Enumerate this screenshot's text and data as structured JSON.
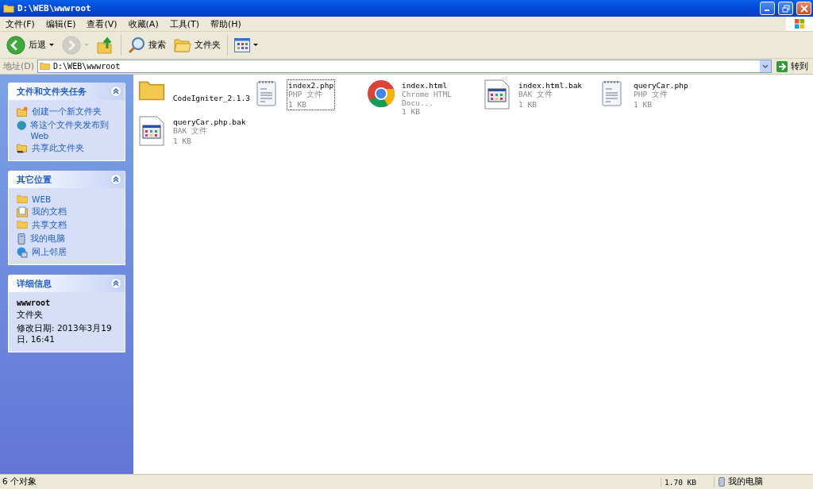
{
  "window": {
    "title": "D:\\WEB\\wwwroot"
  },
  "menu": [
    "文件(F)",
    "编辑(E)",
    "查看(V)",
    "收藏(A)",
    "工具(T)",
    "帮助(H)"
  ],
  "toolbar": [
    {
      "kind": "back",
      "label": "后退",
      "disabled": false
    },
    {
      "kind": "forward",
      "disabled": true
    },
    {
      "kind": "up",
      "disabled": false
    },
    {
      "kind": "search",
      "label": "搜索",
      "disabled": false
    },
    {
      "kind": "folders",
      "label": "文件夹",
      "disabled": false
    },
    {
      "kind": "views",
      "disabled": false
    }
  ],
  "address": {
    "label": "地址(D)",
    "value": "D:\\WEB\\wwwroot",
    "go": "转到"
  },
  "sidebar": [
    {
      "kind": "links",
      "title": "文件和文件夹任务",
      "items": [
        {
          "kind": "new-folder",
          "label": "创建一个新文件夹"
        },
        {
          "kind": "globe",
          "label": "将这个文件夹发布到 Web"
        },
        {
          "kind": "share",
          "label": "共享此文件夹"
        }
      ]
    },
    {
      "kind": "links",
      "title": "其它位置",
      "items": [
        {
          "kind": "folder",
          "label": "WEB"
        },
        {
          "kind": "documents",
          "label": "我的文档"
        },
        {
          "kind": "folder",
          "label": "共享文档"
        },
        {
          "kind": "computer",
          "label": "我的电脑"
        },
        {
          "kind": "network",
          "label": "网上邻居"
        }
      ]
    },
    {
      "kind": "details",
      "title": "详细信息",
      "name": "wwwroot",
      "type": "文件夹",
      "modified": "修改日期: 2013年3月19日, 16:41"
    }
  ],
  "files": [
    {
      "kind": "folder",
      "name": "CodeIgniter_2.1.3",
      "focused": false
    },
    {
      "kind": "text",
      "name": "index2.php",
      "type": "PHP 文件",
      "size": "1 KB",
      "focused": true
    },
    {
      "kind": "browser",
      "name": "index.html",
      "type": "Chrome HTML Docu...",
      "size": "1 KB",
      "focused": false
    },
    {
      "kind": "window",
      "name": "index.html.bak",
      "type": "BAK 文件",
      "size": "1 KB",
      "focused": false
    },
    {
      "kind": "text",
      "name": "queryCar.php",
      "type": "PHP 文件",
      "size": "1 KB",
      "focused": false
    },
    {
      "kind": "window",
      "name": "queryCar.php.bak",
      "type": "BAK 文件",
      "size": "1 KB",
      "focused": false
    }
  ],
  "status_bar": {
    "count": "6 个对象",
    "size": "1.70 KB",
    "zone": "我的电脑"
  }
}
